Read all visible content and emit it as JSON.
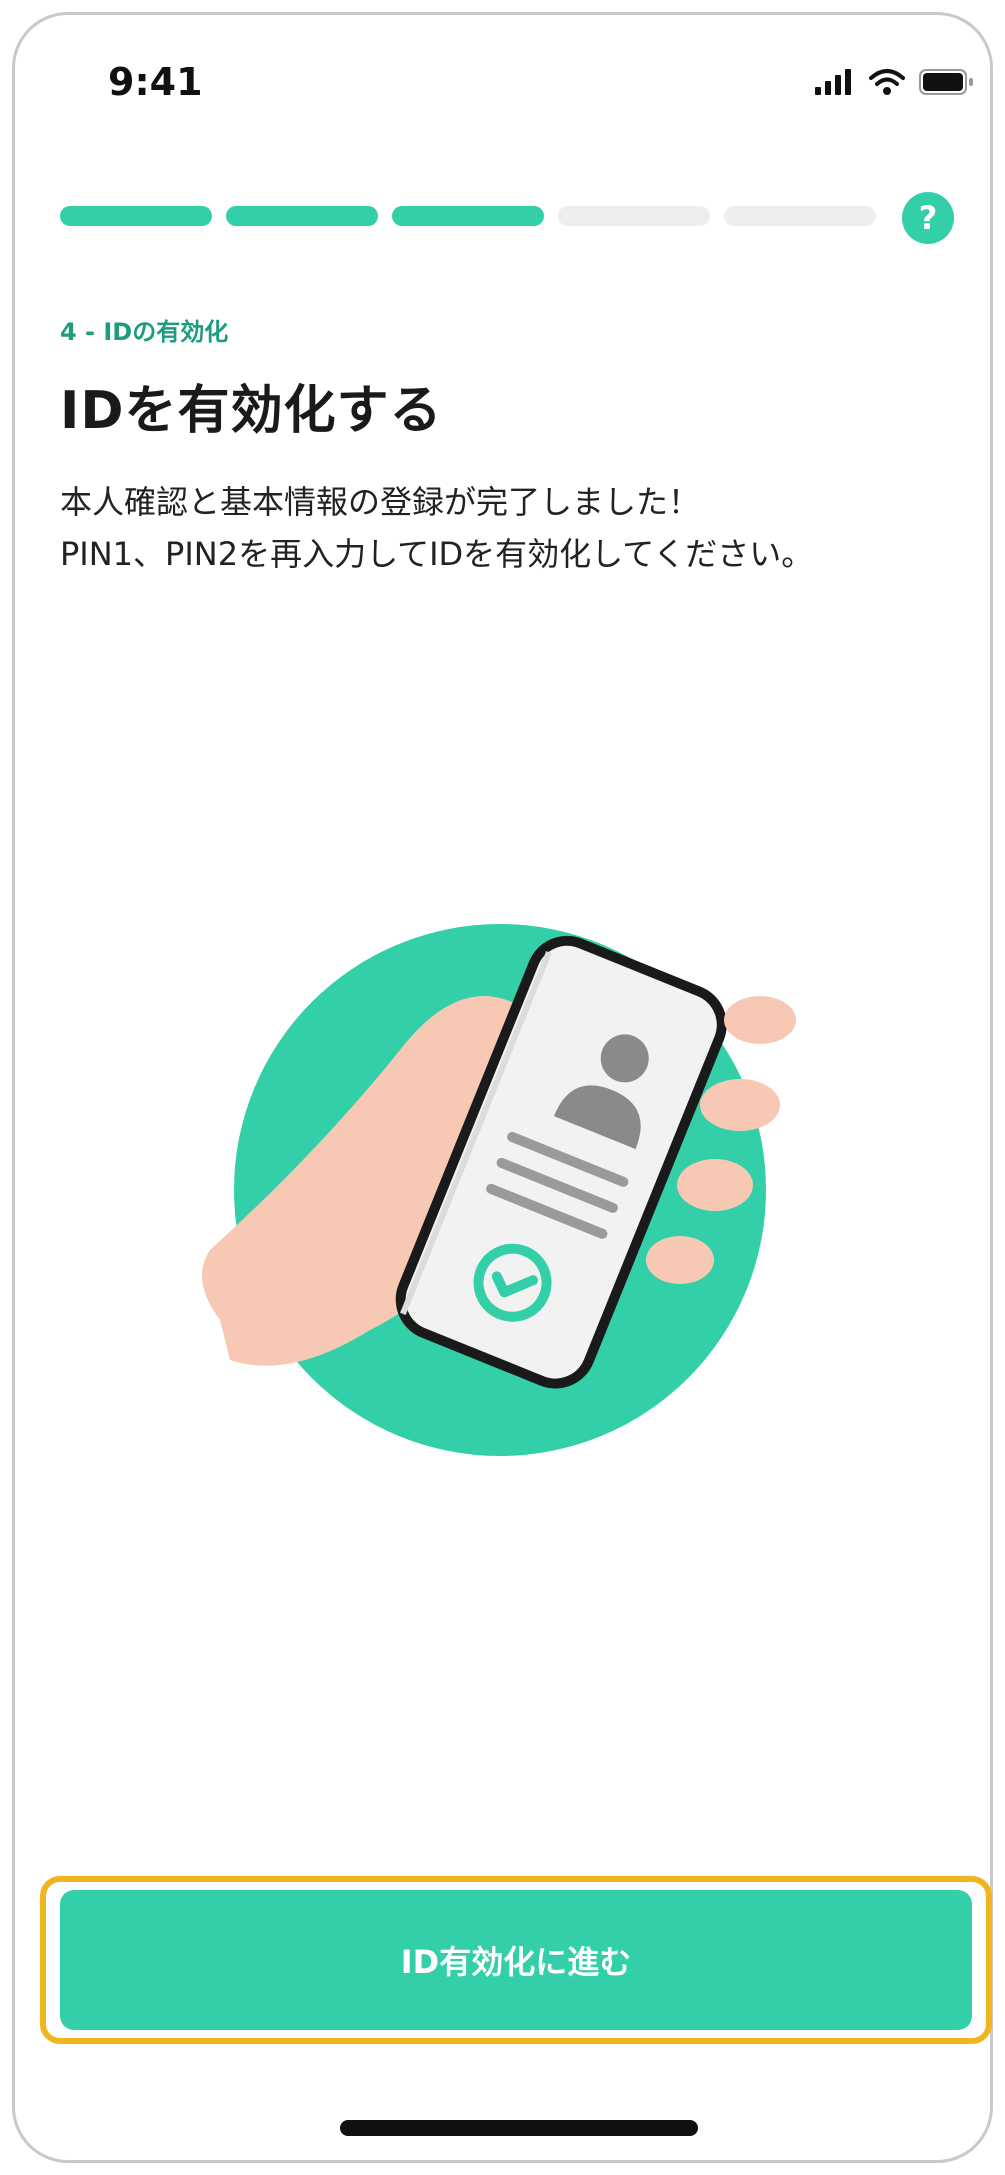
{
  "status_bar": {
    "time": "9:41"
  },
  "progress": {
    "total_steps": 5,
    "completed_steps": 3,
    "active_color": "#33cfa8",
    "inactive_color": "#eeeeee"
  },
  "header": {
    "help_label": "?"
  },
  "content": {
    "step_label": "4 - IDの有効化",
    "title": "IDを有効化する",
    "description_line1": "本人確認と基本情報の登録が完了しました！",
    "description_line2": "PIN1、PIN2を再入力してIDを有効化してください。"
  },
  "footer": {
    "primary_button_label": "ID有効化に進む"
  },
  "colors": {
    "accent": "#33cfa8",
    "accent_text": "#1e9c7f",
    "highlight": "#f0b41e"
  },
  "icons": [
    "signal-icon",
    "wifi-icon",
    "battery-icon",
    "help-icon",
    "user-icon",
    "check-circle-icon"
  ]
}
